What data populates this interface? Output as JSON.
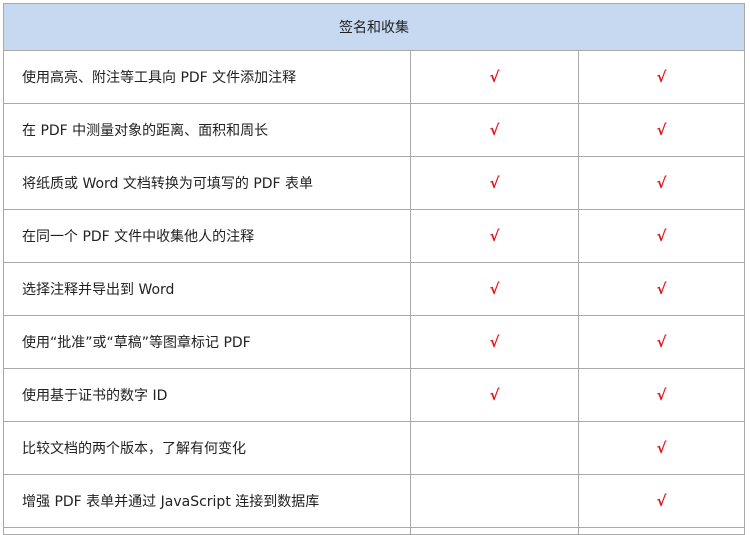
{
  "section": {
    "title": "签名和收集"
  },
  "check_mark": "√",
  "check_color": "#e8141c",
  "header_bg": "#c6d9f1",
  "rows": [
    {
      "label": "使用高亮、附注等工具向 PDF 文件添加注释",
      "col2": true,
      "col3": true
    },
    {
      "label": "在 PDF 中测量对象的距离、面积和周长",
      "col2": true,
      "col3": true
    },
    {
      "label": "将纸质或 Word 文档转换为可填写的 PDF 表单",
      "col2": true,
      "col3": true
    },
    {
      "label": "在同一个 PDF 文件中收集他人的注释",
      "col2": true,
      "col3": true
    },
    {
      "label": "选择注释并导出到 Word",
      "col2": true,
      "col3": true
    },
    {
      "label": "使用“批准”或“草稿”等图章标记 PDF",
      "col2": true,
      "col3": true
    },
    {
      "label": "使用基于证书的数字 ID",
      "col2": true,
      "col3": true
    },
    {
      "label": "比较文档的两个版本，了解有何变化",
      "col2": false,
      "col3": true
    },
    {
      "label": "增强 PDF 表单并通过 JavaScript 连接到数据库",
      "col2": false,
      "col3": true
    }
  ]
}
